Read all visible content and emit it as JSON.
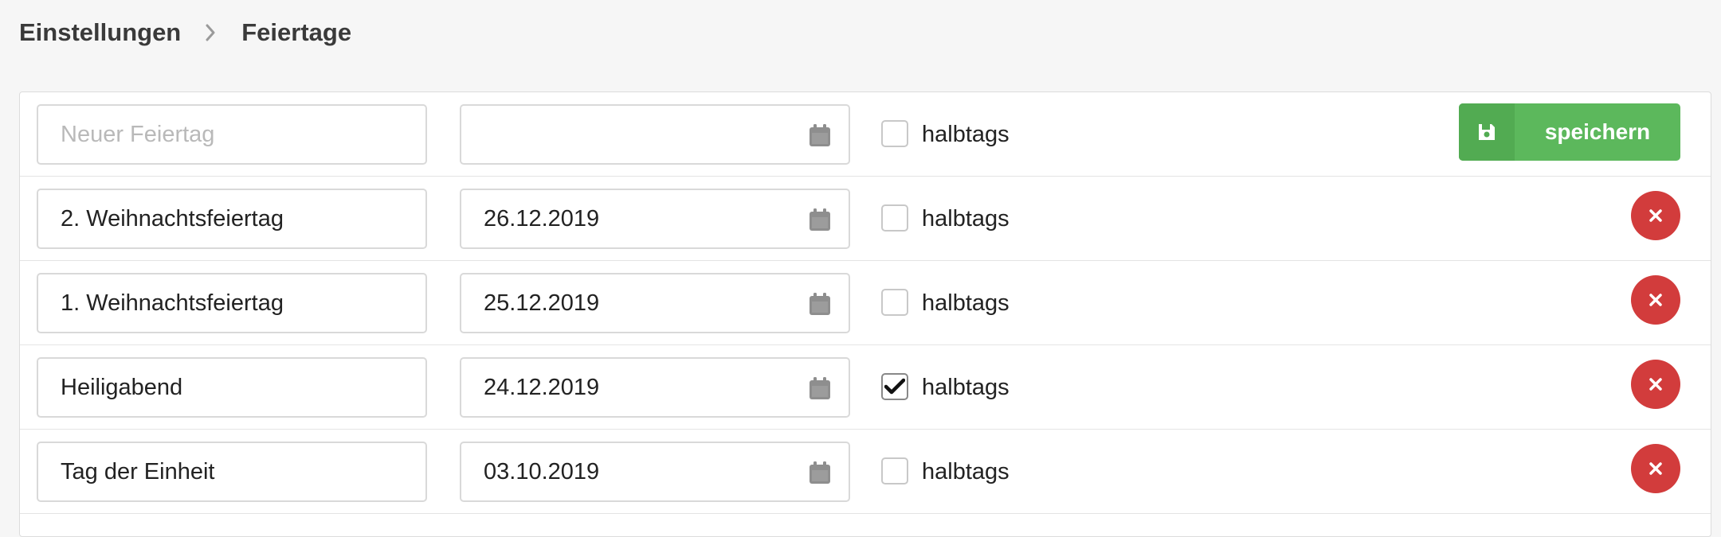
{
  "breadcrumb": {
    "parent": "Einstellungen",
    "current": "Feiertage"
  },
  "new_row": {
    "name_placeholder": "Neuer Feiertag",
    "name_value": "",
    "date_value": "",
    "half_day_label": "halbtags",
    "half_day_checked": false,
    "save_label": "speichern"
  },
  "holidays": [
    {
      "name": "2. Weihnachtsfeiertag",
      "date": "26.12.2019",
      "half_day_label": "halbtags",
      "half_day_checked": false
    },
    {
      "name": "1. Weihnachtsfeiertag",
      "date": "25.12.2019",
      "half_day_label": "halbtags",
      "half_day_checked": false
    },
    {
      "name": "Heiligabend",
      "date": "24.12.2019",
      "half_day_label": "halbtags",
      "half_day_checked": true
    },
    {
      "name": "Tag der Einheit",
      "date": "03.10.2019",
      "half_day_label": "halbtags",
      "half_day_checked": false
    }
  ],
  "icons": {
    "breadcrumb_separator": "chevron-right-icon",
    "date": "calendar-icon",
    "save": "floppy-disk-icon",
    "delete": "close-icon",
    "checked": "checkmark-icon"
  },
  "colors": {
    "save_button": "#5cb85c",
    "delete_button": "#d23c3c",
    "background": "#f6f6f6"
  }
}
